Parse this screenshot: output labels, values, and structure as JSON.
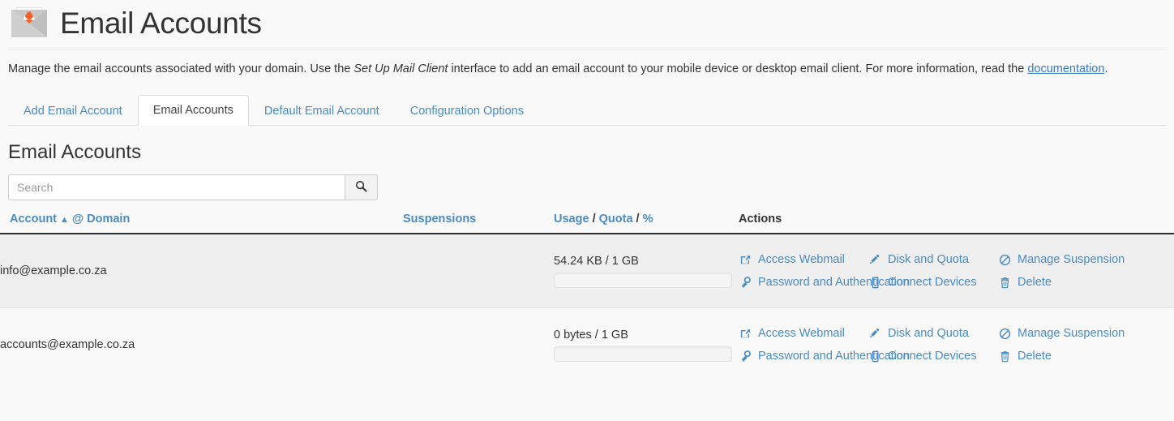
{
  "header": {
    "title": "Email Accounts",
    "icon": "email-accounts-icon"
  },
  "description": {
    "part1": "Manage the email accounts associated with your domain. Use the ",
    "emphasis": "Set Up Mail Client",
    "part2": " interface to add an email account to your mobile device or desktop email client. For more information, read the ",
    "link": "documentation",
    "part3": "."
  },
  "tabs": [
    {
      "label": "Add Email Account",
      "active": false
    },
    {
      "label": "Email Accounts",
      "active": true
    },
    {
      "label": "Default Email Account",
      "active": false
    },
    {
      "label": "Configuration Options",
      "active": false
    }
  ],
  "section": {
    "title": "Email Accounts"
  },
  "search": {
    "value": "",
    "placeholder": "Search",
    "button_icon": "search-icon"
  },
  "table": {
    "headers": {
      "account": "Account",
      "sort_caret": "▲",
      "at": "@",
      "domain": "Domain",
      "suspensions": "Suspensions",
      "usage": "Usage",
      "sep1": "/",
      "quota": "Quota",
      "sep2": "/",
      "percent": "%",
      "actions": "Actions"
    },
    "rows": [
      {
        "account": "info@example.co.za",
        "suspensions": "",
        "usage_text": "54.24 KB / 1 GB",
        "usage_percent": 0,
        "actions": [
          {
            "label": "Access Webmail",
            "icon": "external-link-icon"
          },
          {
            "label": "Disk and Quota",
            "icon": "pencil-icon"
          },
          {
            "label": "Manage Suspension",
            "icon": "ban-icon"
          },
          {
            "label": "Password and Authentication",
            "icon": "key-icon"
          },
          {
            "label": "Connect Devices",
            "icon": "mobile-device-icon"
          },
          {
            "label": "Delete",
            "icon": "trash-icon"
          }
        ]
      },
      {
        "account": "accounts@example.co.za",
        "suspensions": "",
        "usage_text": "0 bytes / 1 GB",
        "usage_percent": 0,
        "actions": [
          {
            "label": "Access Webmail",
            "icon": "external-link-icon"
          },
          {
            "label": "Disk and Quota",
            "icon": "pencil-icon"
          },
          {
            "label": "Manage Suspension",
            "icon": "ban-icon"
          },
          {
            "label": "Password and Authentication",
            "icon": "key-icon"
          },
          {
            "label": "Connect Devices",
            "icon": "mobile-device-icon"
          },
          {
            "label": "Delete",
            "icon": "trash-icon"
          }
        ]
      }
    ]
  },
  "colors": {
    "link": "#4a8bc2",
    "accent_orange": "#f4622c",
    "page_background": "#f9f9f9",
    "row_alt_background": "#efefef",
    "header_rule": "#2f2f2f"
  }
}
